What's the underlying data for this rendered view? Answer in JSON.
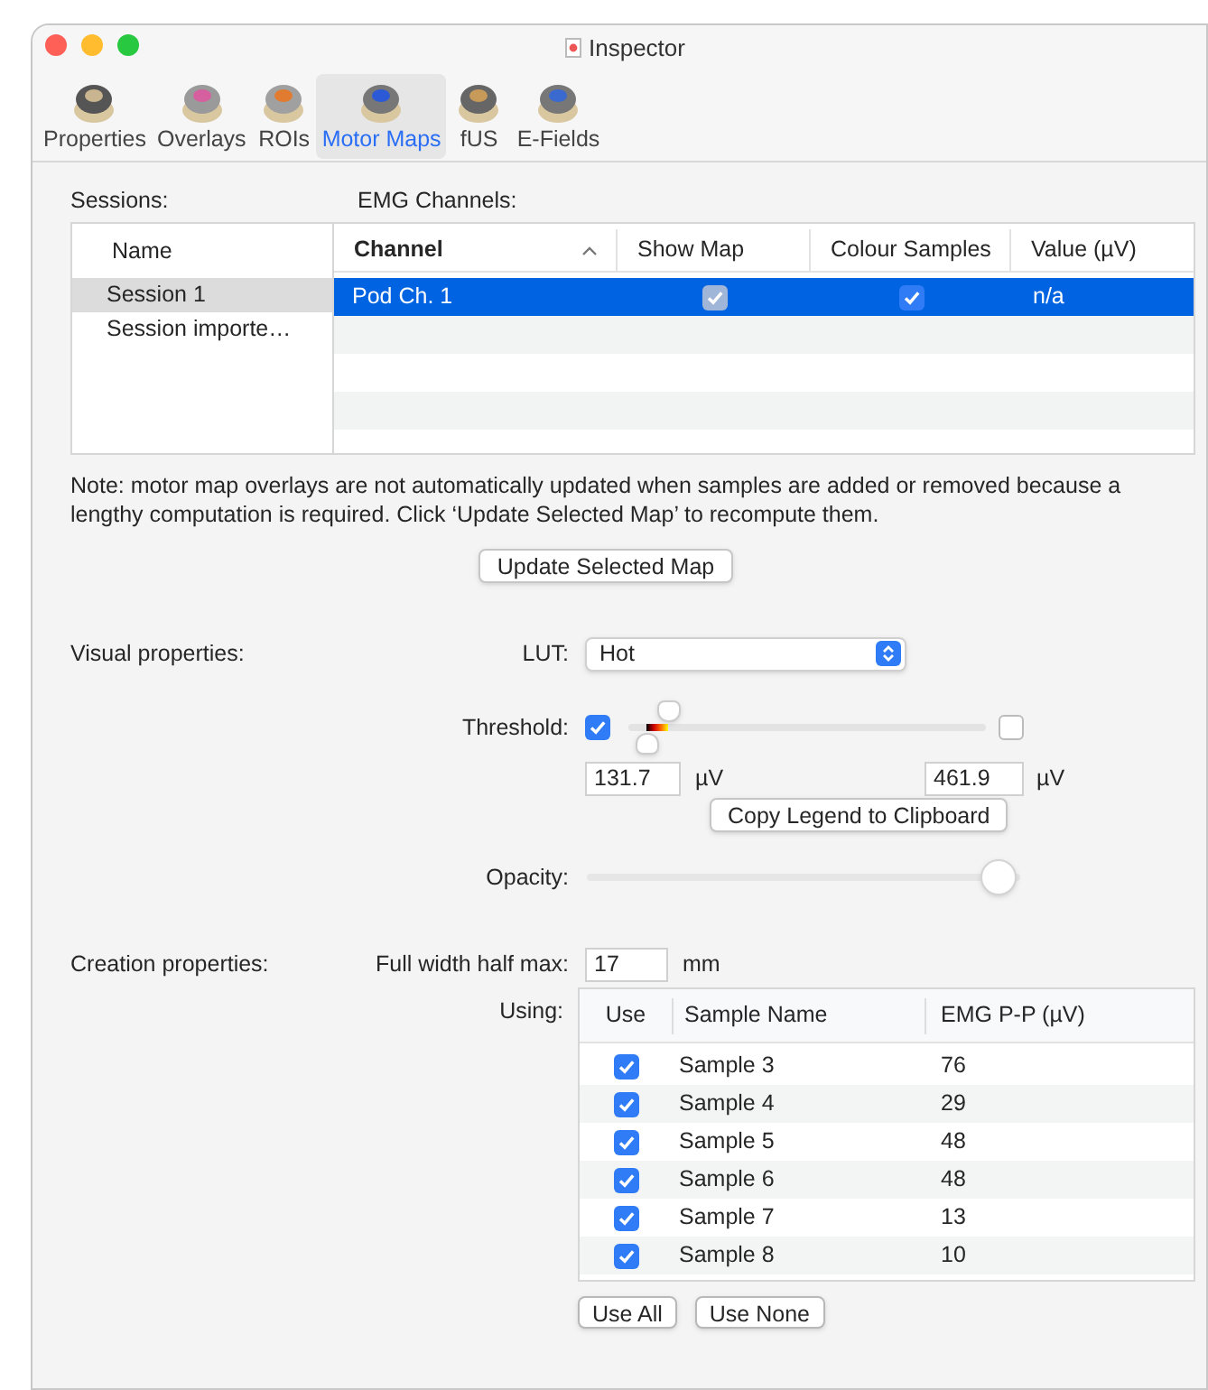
{
  "window": {
    "title": "Inspector"
  },
  "tabs": [
    {
      "label": "Properties",
      "selected": false
    },
    {
      "label": "Overlays",
      "selected": false
    },
    {
      "label": "ROIs",
      "selected": false
    },
    {
      "label": "Motor Maps",
      "selected": true
    },
    {
      "label": "fUS",
      "selected": false
    },
    {
      "label": "E-Fields",
      "selected": false
    }
  ],
  "sessions": {
    "label": "Sessions:",
    "column": "Name",
    "items": [
      {
        "name": "Session 1",
        "selected": true
      },
      {
        "name": "Session importe…",
        "selected": false
      }
    ]
  },
  "channels": {
    "label": "EMG Channels:",
    "columns": [
      "Channel",
      "Show Map",
      "Colour Samples",
      "Value (µV)"
    ],
    "rows": [
      {
        "channel": "Pod Ch. 1",
        "show_map": true,
        "show_map_disabled": true,
        "colour_samples": true,
        "value": "n/a",
        "selected": true
      }
    ]
  },
  "note": "Note: motor map overlays are not automatically updated when samples are added or removed because a lengthy computation is required. Click ‘Update Selected Map’ to recompute them.",
  "update_button": "Update Selected Map",
  "visual": {
    "label": "Visual properties:",
    "lut_label": "LUT:",
    "lut": "Hot",
    "threshold_label": "Threshold:",
    "threshold_low_enabled": true,
    "threshold_high_enabled": false,
    "threshold_low": {
      "level": 0.05
    },
    "threshold_high": {
      "level": 0.11
    },
    "low_value": "131.7",
    "low_unit": "µV",
    "high_value": "461.9",
    "high_unit": "µV",
    "copy_button": "Copy Legend to Clipboard",
    "opacity_label": "Opacity:",
    "opacity": {
      "level": 0.95
    }
  },
  "creation": {
    "label": "Creation properties:",
    "fwhm_label": "Full width half max:",
    "fwhm": "17",
    "fwhm_unit": "mm",
    "using_label": "Using:",
    "columns": [
      "Use",
      "Sample Name",
      "EMG P-P (µV)"
    ],
    "samples": [
      {
        "use": true,
        "name": "Sample 3",
        "value": "76"
      },
      {
        "use": true,
        "name": "Sample 4",
        "value": "29"
      },
      {
        "use": true,
        "name": "Sample 5",
        "value": "48"
      },
      {
        "use": true,
        "name": "Sample 6",
        "value": "48"
      },
      {
        "use": true,
        "name": "Sample 7",
        "value": "13"
      },
      {
        "use": true,
        "name": "Sample 8",
        "value": "10"
      }
    ],
    "buttons": [
      "Use All",
      "Use None"
    ]
  }
}
